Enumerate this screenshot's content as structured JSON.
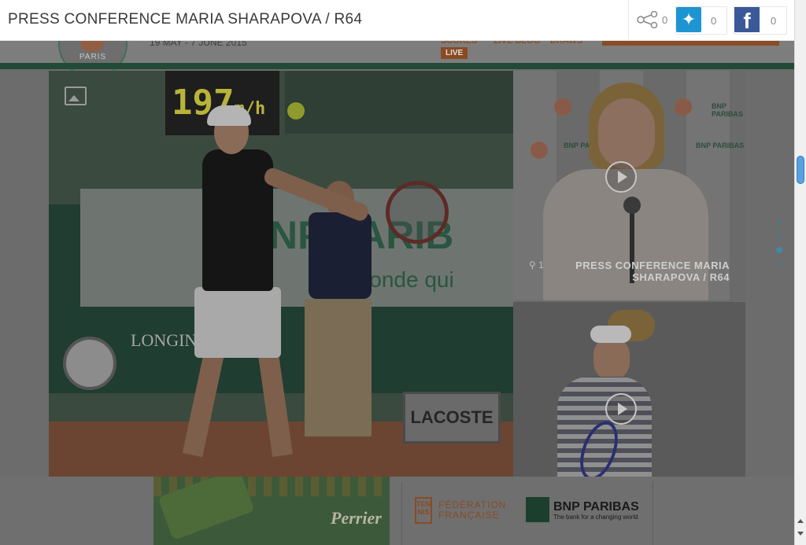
{
  "overlay": {
    "title": "PRESS CONFERENCE MARIA SHARAPOVA / R64",
    "share_count": "0",
    "twitter_count": "0",
    "facebook_count": "0",
    "twitter_icon": "twitter-icon",
    "facebook_icon": "facebook-icon",
    "share_icon": "share-icon"
  },
  "site": {
    "dates": "19 MAY - 7 JUNE 2015",
    "logo_text": "PARIS",
    "nav": {
      "scores": "SCORES",
      "live": "LIVE",
      "live_blog": "LIVE BLOG",
      "draws": "DRAWS"
    }
  },
  "main_photo": {
    "speed_value": "197",
    "speed_unit": "m/h",
    "longines": "LONGIN",
    "lacoste": "LACOSTE",
    "banner_text": "NP PARIB",
    "banner_sub": "un monde qui",
    "photo_icon": "image-icon"
  },
  "videos": [
    {
      "title": "PRESS CONFERENCE MARIA SHARAPOVA / R64",
      "share_count": "1",
      "bnp_label": "BNP PARIBAS"
    },
    {
      "title": ""
    }
  ],
  "partners": {
    "perrier": "Perrier",
    "fft_box": "TEN NIS",
    "fft_line1": "FÉDÉRATION",
    "fft_line2": "FRANÇAISE",
    "bnp_name": "BNP PARIBAS",
    "bnp_tagline": "The bank for a changing world"
  },
  "colors": {
    "accent_green": "#234a37",
    "accent_orange": "#8a4b24",
    "twitter": "#1d95d2",
    "facebook": "#3b5998"
  }
}
